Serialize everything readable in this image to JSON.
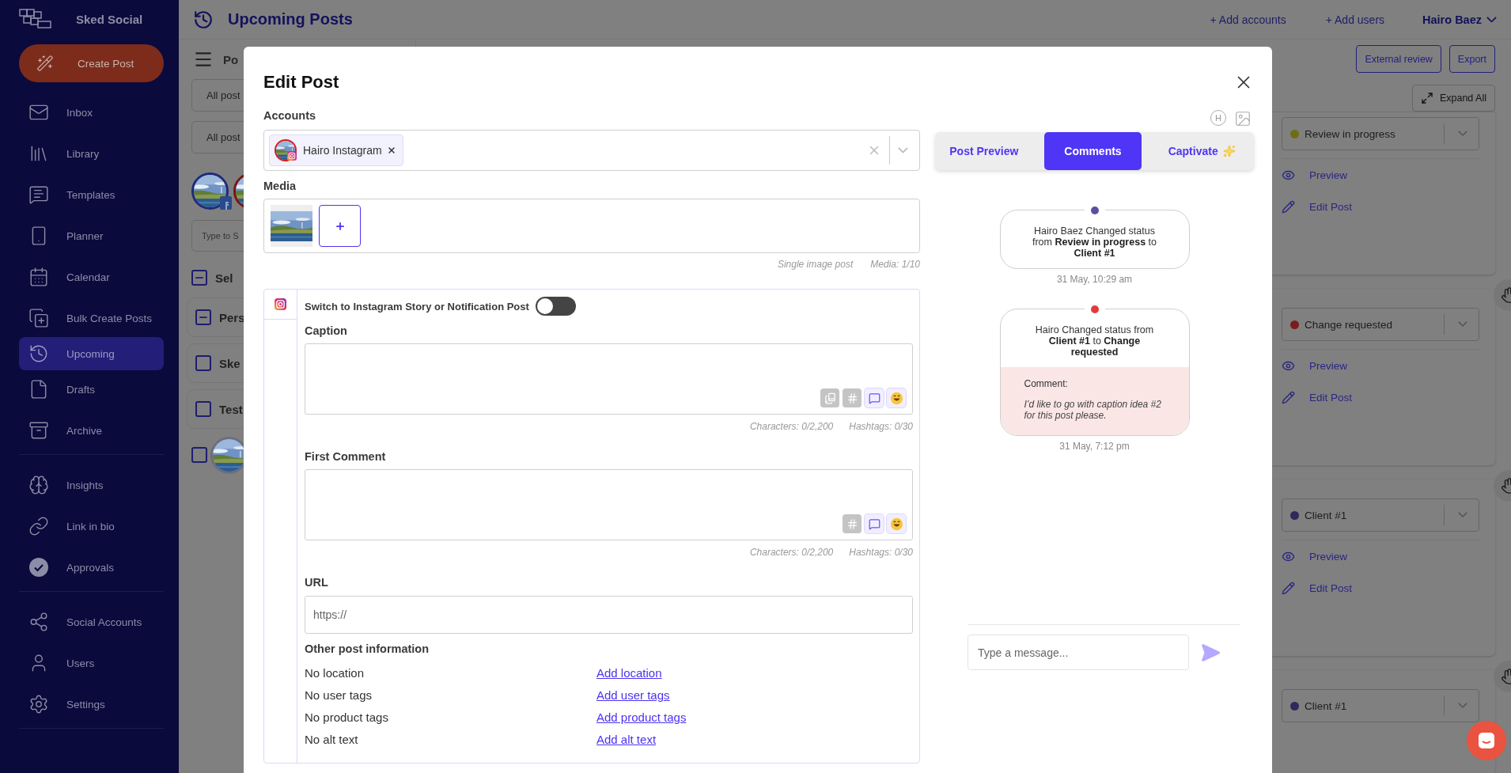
{
  "sidebar": {
    "brand": "Sked Social",
    "create_button": "Create Post",
    "sections": [
      {
        "items": [
          {
            "label": "Inbox",
            "selected": false
          },
          {
            "label": "Library",
            "selected": false
          },
          {
            "label": "Templates",
            "selected": false
          },
          {
            "label": "Planner",
            "selected": false
          },
          {
            "label": "Calendar",
            "selected": false
          },
          {
            "label": "Bulk Create Posts",
            "selected": false
          },
          {
            "label": "Upcoming",
            "selected": true
          },
          {
            "label": "Drafts",
            "selected": false
          },
          {
            "label": "Archive",
            "selected": false
          }
        ]
      },
      {
        "items": [
          {
            "label": "Insights",
            "selected": false
          },
          {
            "label": "Link in bio",
            "selected": false
          },
          {
            "label": "Approvals",
            "selected": false
          }
        ]
      },
      {
        "items": [
          {
            "label": "Social Accounts",
            "selected": false
          },
          {
            "label": "Users",
            "selected": false
          },
          {
            "label": "Settings",
            "selected": false
          }
        ]
      }
    ]
  },
  "header": {
    "title": "Upcoming Posts",
    "links": [
      "+ Add accounts",
      "+ Add users"
    ],
    "user": "Hairo Baez"
  },
  "posts_panel": {
    "title": "Po",
    "filters": [
      "All post",
      "All post"
    ],
    "search_placeholder": "Type to S",
    "select_all": {
      "label": "Sel",
      "partial": true
    },
    "groups": [
      {
        "label": "Pers",
        "partial": true
      },
      {
        "label": "Ske",
        "partial": false
      },
      {
        "label": "Test",
        "partial": false
      }
    ],
    "post_rows": [
      {
        "checked": false
      }
    ]
  },
  "toolbar": {
    "buttons": [
      "External review",
      "Export"
    ],
    "expand": "Expand All"
  },
  "cards": [
    {
      "status": "Review in progress",
      "color": "#6e6d14",
      "links": [
        "Preview",
        "Edit Post"
      ]
    },
    {
      "status": "Change requested",
      "color": "#7a1c1c",
      "links": [
        "Preview",
        "Edit Post"
      ]
    },
    {
      "status": "Client #1",
      "color": "#2e2a5c",
      "links": [
        "Preview",
        "Edit Post"
      ]
    },
    {
      "status": "Client #1",
      "color": "#2e2a5c"
    }
  ],
  "modal": {
    "title": "Edit Post",
    "accounts": {
      "label": "Accounts",
      "chips": [
        {
          "name": "Hairo Instagram"
        }
      ]
    },
    "media": {
      "label": "Media",
      "meta": [
        "Single image post",
        "Media: 1/10"
      ]
    },
    "instagram": {
      "switch_label": "Switch to Instagram Story or Notification Post",
      "on": false
    },
    "caption": {
      "label": "Caption",
      "counts": [
        "Characters: 0/2,200",
        "Hashtags: 0/30"
      ]
    },
    "first_comment": {
      "label": "First Comment",
      "counts": [
        "Characters: 0/2,200",
        "Hashtags: 0/30"
      ]
    },
    "url": {
      "label": "URL",
      "placeholder": "https://"
    },
    "other": {
      "title": "Other post information",
      "rows": [
        {
          "status": "No location",
          "link": "Add location"
        },
        {
          "status": "No user tags",
          "link": "Add user tags"
        },
        {
          "status": "No product tags",
          "link": "Add product tags"
        },
        {
          "status": "No alt text",
          "link": "Add alt text"
        }
      ]
    },
    "header_badge": "H",
    "tabs": [
      {
        "label": "Post Preview",
        "selected": false
      },
      {
        "label": "Comments",
        "selected": true
      },
      {
        "label": "Captivate",
        "selected": false
      }
    ],
    "timeline": [
      {
        "text": "Hairo Baez Changed status from **Review in progress** to **Client #1**",
        "color": "#5b4fa3",
        "time": "31 May, 10:29 am"
      },
      {
        "text": "Hairo Changed status from **Client #1** to **Change requested**",
        "color": "#e23b3b",
        "comment_label": "Comment:",
        "comment": "I’d like to go with caption idea #2 for this post please.",
        "time": "31 May, 7:12 pm"
      }
    ],
    "message": {
      "placeholder": "Type a message..."
    }
  }
}
